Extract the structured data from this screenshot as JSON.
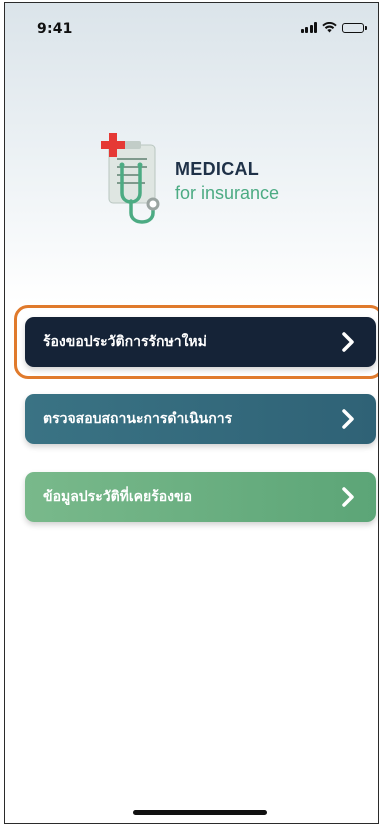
{
  "status_bar": {
    "time": "9:41",
    "icons": [
      "signal-icon",
      "wifi-icon",
      "battery-icon"
    ]
  },
  "logo": {
    "title": "MEDICAL",
    "subtitle": "for insurance",
    "icon": "medical-clipboard-stethoscope-icon",
    "colors": {
      "cross": "#e53935",
      "title": "#1f3148",
      "subtitle": "#4cab83"
    }
  },
  "menu": {
    "items": [
      {
        "label": "ร้องขอประวัติการรักษาใหม่",
        "icon": "chevron-right-icon",
        "color": "#152337",
        "highlighted": true
      },
      {
        "label": "ตรวจสอบสถานะการดำเนินการ",
        "icon": "chevron-right-icon",
        "color": "#3a7384",
        "highlighted": false
      },
      {
        "label": "ข้อมูลประวัติที่เคยร้องขอ",
        "icon": "chevron-right-icon",
        "color": "#6bb07f",
        "highlighted": false
      }
    ],
    "highlight_color": "#e07a2c"
  }
}
